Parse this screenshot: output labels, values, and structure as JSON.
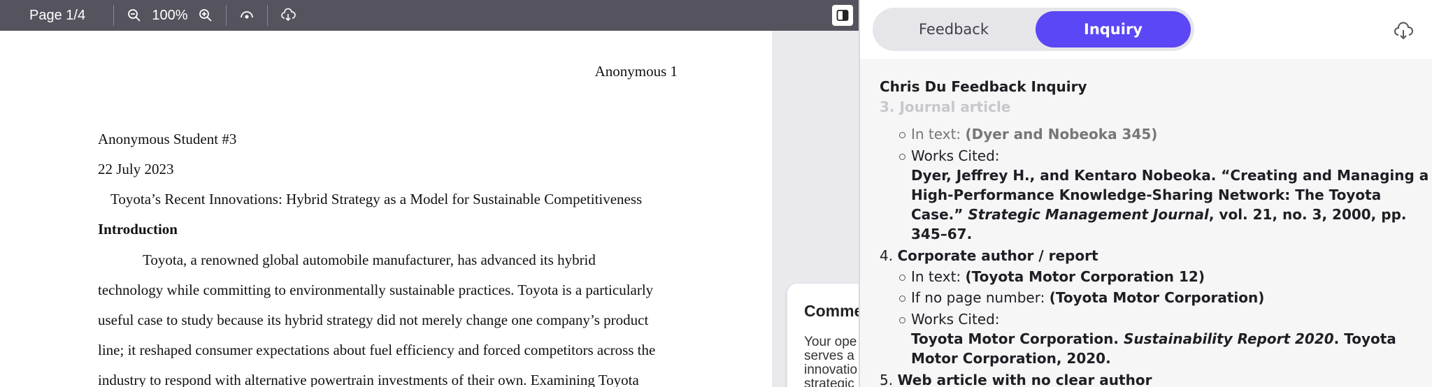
{
  "viewer": {
    "page_indicator": "Page 1/4",
    "zoom": "100%",
    "document": {
      "header_name": "Anonymous 1",
      "author": "Anonymous Student #3",
      "date": "22 July 2023",
      "title": "Toyota’s Recent Innovations: Hybrid Strategy as a Model for Sustainable Competitiveness",
      "section_heading": "Introduction",
      "body_lines": [
        "Toyota, a renowned global automobile manufacturer, has advanced its hybrid",
        "technology while committing to environmentally sustainable practices. Toyota is a particularly",
        "useful case to study because its hybrid strategy did not merely change one company’s product",
        "line; it reshaped consumer expectations about fuel efficiency and forced competitors across the",
        "industry to respond with alternative powertrain investments of their own. Examining Toyota"
      ]
    },
    "comment_card": {
      "title": "Comme",
      "body_lines": [
        "Your ope",
        "serves a",
        "innovatio",
        "strategic"
      ]
    }
  },
  "sidebar": {
    "tabs": {
      "feedback": "Feedback",
      "inquiry": "Inquiry"
    },
    "heading": "Chris Du Feedback Inquiry",
    "faded_item": "3. Journal article",
    "item3": {
      "in_text_label": "In text:",
      "in_text_value": "(Dyer and Nobeoka 345)",
      "works_cited_label": "Works Cited:",
      "citation_line1": "Dyer, Jeffrey H., and Kentaro Nobeoka. “Creating and Managing a",
      "citation_line2": "High-Performance Knowledge-Sharing Network: The Toyota",
      "citation_line3_pre": "Case.” ",
      "citation_line3_journal": "Strategic Management Journal",
      "citation_line3_post": ", vol. 21, no. 3, 2000, pp.",
      "citation_line4": "345–67."
    },
    "item4": {
      "number": "4.",
      "title": "Corporate author / report",
      "in_text_label": "In text:",
      "in_text_value": "(Toyota Motor Corporation 12)",
      "no_page_label": "If no page number:",
      "no_page_value": "(Toyota Motor Corporation)",
      "works_cited_label": "Works Cited:",
      "citation_pre": "Toyota Motor Corporation. ",
      "citation_report": "Sustainability Report 2020",
      "citation_post": ". Toyota",
      "citation_line2": "Motor Corporation, 2020."
    },
    "item5": {
      "number": "5.",
      "title": "Web article with no clear author"
    }
  }
}
